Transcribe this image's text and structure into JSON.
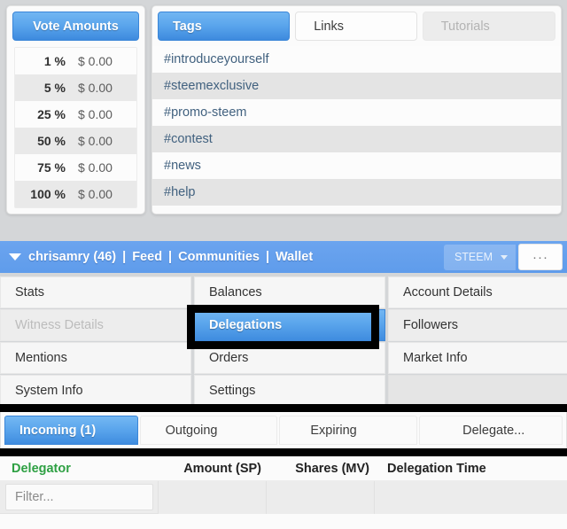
{
  "vote_panel": {
    "header": "Vote Amounts",
    "rows": [
      {
        "pct": "1 %",
        "amount": "$ 0.00"
      },
      {
        "pct": "5 %",
        "amount": "$ 0.00"
      },
      {
        "pct": "25 %",
        "amount": "$ 0.00"
      },
      {
        "pct": "50 %",
        "amount": "$ 0.00"
      },
      {
        "pct": "75 %",
        "amount": "$ 0.00"
      },
      {
        "pct": "100 %",
        "amount": "$ 0.00"
      }
    ]
  },
  "tags_panel": {
    "tabs": [
      {
        "label": "Tags",
        "state": "active"
      },
      {
        "label": "Links",
        "state": "idle"
      },
      {
        "label": "Tutorials",
        "state": "disabled"
      }
    ],
    "tags": [
      "#introduceyourself",
      "#steemexclusive",
      "#promo-steem",
      "#contest",
      "#news",
      "#help"
    ]
  },
  "navbar": {
    "username": "chrisamry (46)",
    "sep": "|",
    "links": [
      "Feed",
      "Communities",
      "Wallet"
    ],
    "chain": "STEEM",
    "more": "···"
  },
  "menu": {
    "items": [
      {
        "label": "Stats",
        "state": "normal"
      },
      {
        "label": "Balances",
        "state": "normal"
      },
      {
        "label": "Account Details",
        "state": "normal"
      },
      {
        "label": "Witness Details",
        "state": "disabled"
      },
      {
        "label": "Delegations",
        "state": "selected"
      },
      {
        "label": "Followers",
        "state": "alt"
      },
      {
        "label": "Mentions",
        "state": "normal"
      },
      {
        "label": "Orders",
        "state": "normal"
      },
      {
        "label": "Market Info",
        "state": "normal"
      },
      {
        "label": "System Info",
        "state": "normal"
      },
      {
        "label": "Settings",
        "state": "normal"
      },
      {
        "label": "",
        "state": "empty"
      }
    ]
  },
  "delegations": {
    "tabs": [
      {
        "label": "Incoming (1)",
        "state": "active"
      },
      {
        "label": "Outgoing",
        "state": "idle"
      },
      {
        "label": "Expiring",
        "state": "idle"
      },
      {
        "label": "Delegate...",
        "state": "idle"
      }
    ],
    "columns": [
      "Delegator",
      "Amount (SP)",
      "Shares (MV)",
      "Delegation Time"
    ],
    "filter_placeholder": "Filter...",
    "rows": []
  },
  "colors": {
    "accent_blue": "#5aa5ec",
    "green_header": "#2ea043",
    "tag_link": "#41617f",
    "page_bg": "#d4d6d8",
    "annotation": "#000000"
  }
}
